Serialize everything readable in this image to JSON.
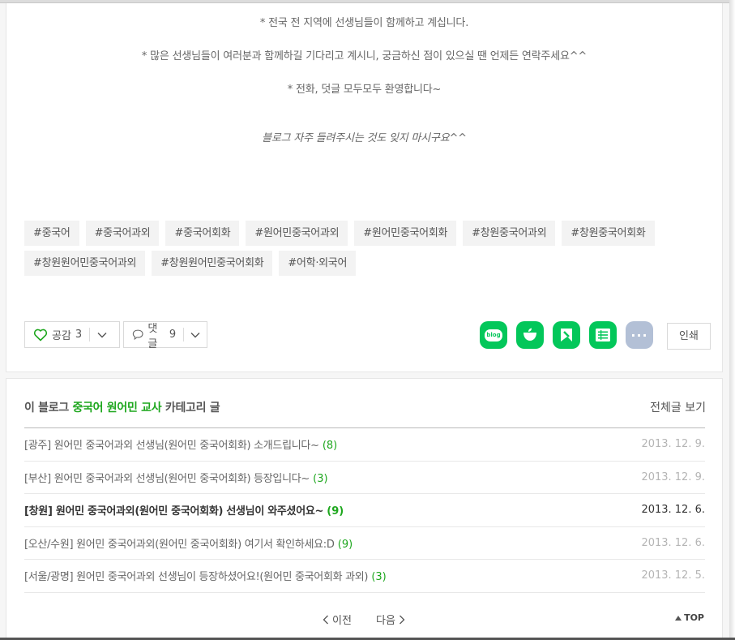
{
  "post": {
    "lines": [
      "* 전국 전 지역에 선생님들이 함께하고 계십니다.",
      "* 많은 선생님들이 여러분과 함께하길 기다리고 계시니, 궁금하신 점이 있으실 땐 언제든 연락주세요^^",
      "* 전화, 덧글 모두모두 환영합니다~",
      "블로그 자주 들려주시는 것도 잊지 마시구요^^"
    ],
    "tags": [
      "#중국어",
      "#중국어과외",
      "#중국어회화",
      "#원어민중국어과외",
      "#원어민중국어회화",
      "#창원중국어과외",
      "#창원중국어회화",
      "#창원원어민중국어과외",
      "#창원원어민중국어회화",
      "#어학·외국어"
    ],
    "like_label": "공감",
    "like_count": "3",
    "comment_label": "댓글",
    "comment_count": "9",
    "share_icons": [
      "blog-share-icon",
      "cafe-share-icon",
      "keep-share-icon",
      "memo-share-icon",
      "more-share-icon"
    ],
    "share_blog_text": "blog",
    "more_text": "···",
    "print_label": "인쇄"
  },
  "related": {
    "head_prefix": "이 블로그",
    "category": "중국어 원어민 교사",
    "head_suffix": "카테고리 글",
    "view_all": "전체글 보기",
    "items": [
      {
        "title": "[광주] 원어민 중국어과외 선생님(원어민 중국어회화) 소개드립니다~",
        "count": "(8)",
        "date": "2013. 12. 9."
      },
      {
        "title": "[부산] 원어민 중국어과외 선생님(원어민 중국어회화) 등장입니다~",
        "count": "(3)",
        "date": "2013. 12. 9."
      },
      {
        "title": "[창원] 원어민 중국어과외(원어민 중국어회화) 선생님이 와주셨어요~",
        "count": "(9)",
        "date": "2013. 12. 6."
      },
      {
        "title": "[오산/수원] 원어민 중국어과외(원어민 중국어회화) 여기서 확인하세요:D",
        "count": "(9)",
        "date": "2013. 12. 6."
      },
      {
        "title": "[서울/광명] 원어민 중국어과외 선생님이 등장하셨어요!(원어민 중국어회화 과외)",
        "count": "(3)",
        "date": "2013. 12. 5."
      }
    ],
    "prev_label": "이전",
    "next_label": "다음",
    "top_label": "TOP"
  },
  "colors": {
    "accent": "#1ea71e",
    "share_green": "#03c75a",
    "share_more": "#b3c0d6"
  }
}
